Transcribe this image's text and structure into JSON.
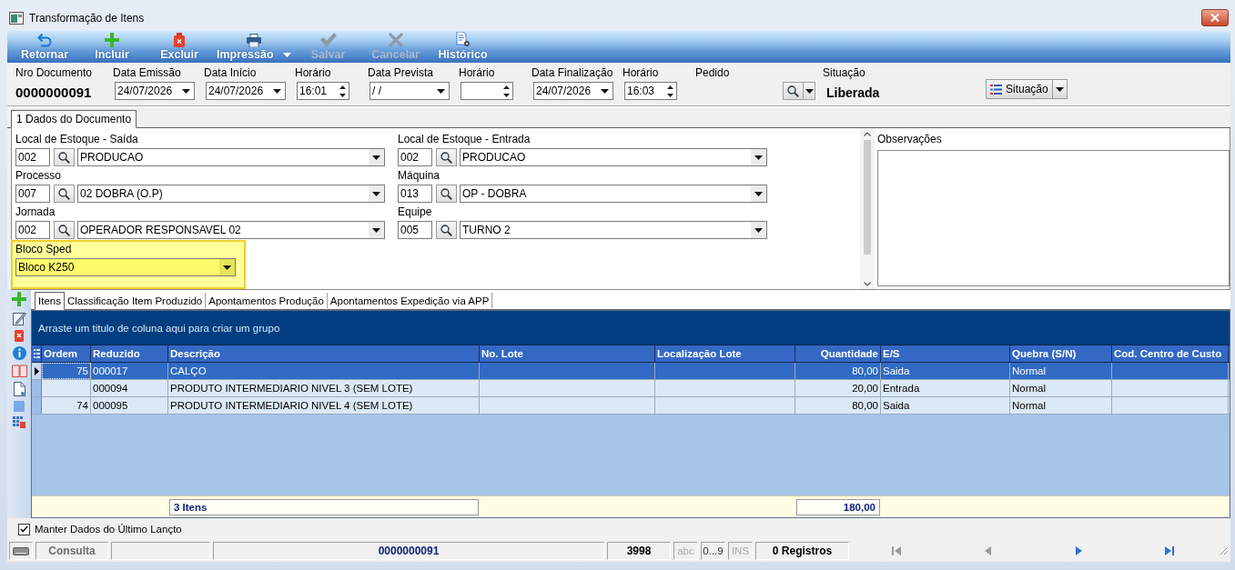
{
  "window": {
    "title": "Transformação de Itens"
  },
  "toolbar": [
    {
      "kind": "back",
      "label": "Retornar",
      "disabled": false,
      "menu": false
    },
    {
      "kind": "add",
      "label": "Incluir",
      "disabled": false,
      "menu": false
    },
    {
      "kind": "delete",
      "label": "Excluir",
      "disabled": false,
      "menu": false
    },
    {
      "kind": "print",
      "label": "Impressão",
      "disabled": false,
      "menu": true
    },
    {
      "kind": "save",
      "label": "Salvar",
      "disabled": true,
      "menu": false
    },
    {
      "kind": "cancel",
      "label": "Cancelar",
      "disabled": true,
      "menu": false
    },
    {
      "kind": "history",
      "label": "Histórico",
      "disabled": false,
      "menu": false
    }
  ],
  "header": {
    "fields": [
      {
        "kind": "display",
        "label": "Nro Documento",
        "value": "0000000091"
      },
      {
        "kind": "date",
        "label": "Data Emissão",
        "value": "24/07/2026"
      },
      {
        "kind": "date",
        "label": "Data Início",
        "value": "24/07/2026"
      },
      {
        "kind": "time",
        "label": "Horário",
        "value": "16:01"
      },
      {
        "kind": "date",
        "label": "Data Prevista",
        "value": "/ /"
      },
      {
        "kind": "time",
        "label": "Horário"
      },
      {
        "kind": "date",
        "label": "Data Finalização",
        "value": "24/07/2026"
      },
      {
        "kind": "time",
        "label": "Horário",
        "value": "16:03"
      },
      {
        "kind": "lookup",
        "label": "Pedido"
      },
      {
        "kind": "display",
        "label": "Situação",
        "value": "Liberada"
      }
    ],
    "status_button": {
      "label": "Situação"
    }
  },
  "document_tabs": [
    {
      "label": "1 Dados do Documento",
      "selected": true
    }
  ],
  "form": {
    "lookups": [
      {
        "label": "Local de Estoque - Saída",
        "code": "002",
        "value": "PRODUCAO"
      },
      {
        "label": "Local de Estoque - Entrada",
        "code": "002",
        "value": "PRODUCAO"
      },
      {
        "label": "Processo",
        "code": "007",
        "value": "02 DOBRA (O.P)"
      },
      {
        "label": "Máquina",
        "code": "013",
        "value": "OP - DOBRA"
      },
      {
        "label": "Jornada",
        "code": "002",
        "value": "OPERADOR RESPONSAVEL 02"
      },
      {
        "label": "Equipe",
        "code": "005",
        "value": "TURNO 2"
      }
    ],
    "bloco_sped": {
      "label": "Bloco Sped",
      "value": "Bloco K250",
      "highlighted": true
    },
    "observacoes": {
      "label": "Observações"
    }
  },
  "grid_tabs": [
    {
      "label": "Itens",
      "selected": true
    },
    {
      "label": "Classificação Item Produzido",
      "selected": false
    },
    {
      "label": "Apontamentos Produção",
      "selected": false
    },
    {
      "label": "Apontamentos Expedição via APP",
      "selected": false
    }
  ],
  "grid": {
    "group_panel": "Arraste um titulo de coluna aqui para criar um grupo",
    "columns": [
      {
        "label": "Ordem",
        "kind": "ordinal"
      },
      {
        "label": "Reduzido",
        "kind": "text"
      },
      {
        "label": "Descrição",
        "kind": "text"
      },
      {
        "label": "No. Lote",
        "kind": "text"
      },
      {
        "label": "Localização Lote",
        "kind": "text"
      },
      {
        "label": "Quantidade",
        "kind": "number"
      },
      {
        "label": "E/S",
        "kind": "text"
      },
      {
        "label": "Quebra (S/N)",
        "kind": "text"
      },
      {
        "label": "Cod. Centro de Custo",
        "kind": "text"
      }
    ],
    "rows": [
      {
        "selected": true,
        "cells": [
          "75",
          "000017",
          "CALÇO",
          null,
          null,
          "80,00",
          "Saida",
          "Normal",
          null
        ]
      },
      {
        "selected": false,
        "cells": [
          null,
          "000094",
          "PRODUTO INTERMEDIARIO NIVEL 3 (SEM LOTE)",
          null,
          null,
          "20,00",
          "Entrada",
          "Normal",
          null
        ]
      },
      {
        "selected": false,
        "cells": [
          "74",
          "000095",
          "PRODUTO INTERMEDIARIO NIVEL 4 (SEM LOTE)",
          null,
          null,
          "80,00",
          "Saida",
          "Normal",
          null
        ]
      }
    ],
    "footer": {
      "count": "3 Itens",
      "total": "180,00"
    }
  },
  "keep_data": {
    "label": "Manter Dados do Último Lançto",
    "checked": true
  },
  "status_bar": {
    "mode": "Consulta",
    "document": "0000000091",
    "code": "3998",
    "indicators": [
      {
        "label": "abc",
        "on": false
      },
      {
        "label": "0...9",
        "on": true
      },
      {
        "label": "INS",
        "on": false
      }
    ],
    "records": "0 Registros",
    "navigation": [
      {
        "kind": "first",
        "disabled": true
      },
      {
        "kind": "previous",
        "disabled": true
      },
      {
        "kind": "next",
        "disabled": false
      },
      {
        "kind": "last",
        "disabled": false
      }
    ]
  }
}
